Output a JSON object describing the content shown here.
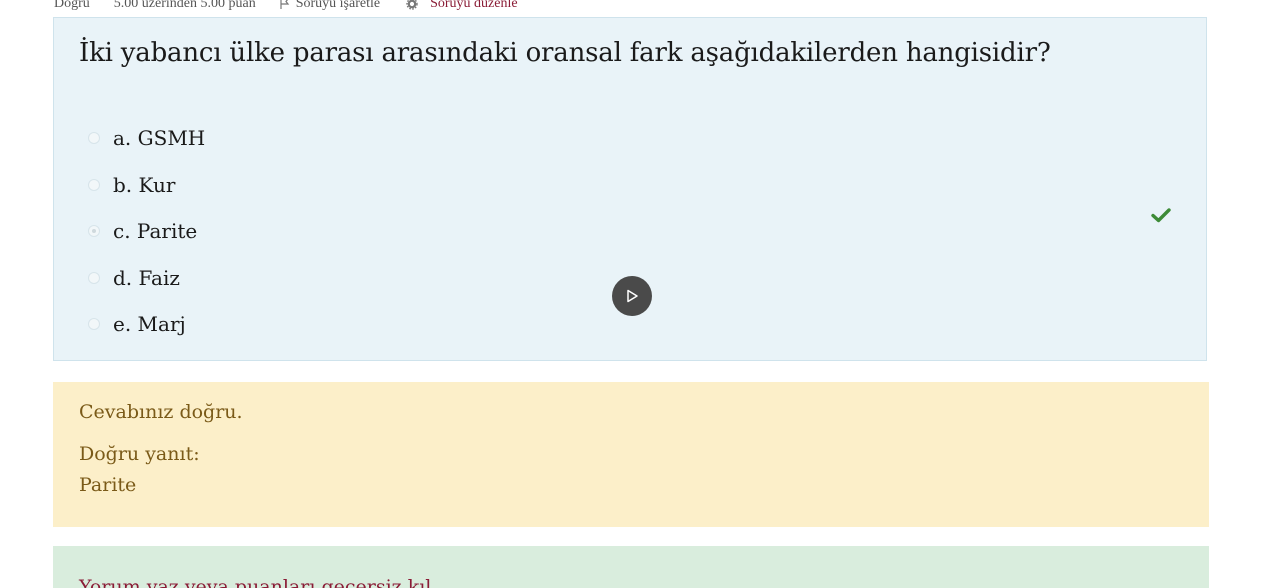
{
  "info": {
    "state": "Doğru",
    "grade": "5.00 üzerinden 5.00 puan",
    "flag_label": "Soruyu işaretle",
    "edit_label": "Soruyu düzenle"
  },
  "question": {
    "text": "İki yabancı ülke parası arasındaki oransal fark aşağıdakilerden hangisidir?",
    "answers": [
      {
        "label": "a. GSMH",
        "selected": false
      },
      {
        "label": "b. Kur",
        "selected": false
      },
      {
        "label": "c. Parite",
        "selected": true
      },
      {
        "label": "d. Faiz",
        "selected": false
      },
      {
        "label": "e. Marj",
        "selected": false
      }
    ],
    "correct_color": "#3d8b37"
  },
  "feedback": {
    "result": "Cevabınız doğru.",
    "right_answer_label": "Doğru yanıt:",
    "right_answer_value": "Parite"
  },
  "comment": {
    "link_text": "Yorum yaz veya puanları geçersiz kıl"
  },
  "colors": {
    "question_bg": "#e9f3f8",
    "feedback_bg": "#fcefc9",
    "comment_bg": "#d9eddd",
    "link": "#8a1c36"
  }
}
